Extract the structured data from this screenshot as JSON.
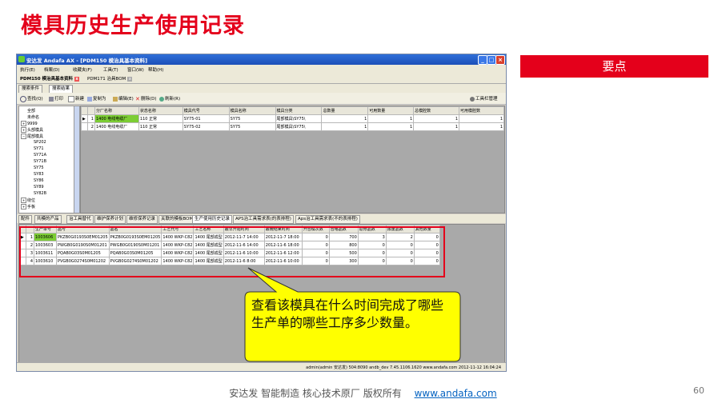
{
  "slide": {
    "title": "模具历史生产使用记录",
    "keypoint_label": "要点",
    "footer_text": "安达发  智能制造 核心技术原厂   版权所有",
    "footer_link": "www.andafa.com",
    "page_number": "60",
    "callout_text": "查看该模具在什么时间完成了哪些生产单的哪些工序多少数量。"
  },
  "window": {
    "title": "安达发 Andafa AX - [PDM150 模治具基本资料]",
    "menu": [
      "执行(E)",
      "档案(D)",
      "收藏夹(F)",
      "工具(T)",
      "窗口(W)",
      "帮助(H)"
    ],
    "doc_tabs": [
      "PDM150 模治具基本资料",
      "PDM171 治具BOM"
    ],
    "sub_tabs": [
      "搜索条件",
      "搜索结果"
    ],
    "toolbar": [
      "查找(Q)",
      "打印",
      "新建",
      "复制为",
      "编辑(E)",
      "删除(D)",
      "刷新(R)"
    ],
    "tool_manage": "工具栏管理",
    "tree": [
      "全部",
      "未命名",
      "9999",
      "头部模具",
      "尾部模具",
      "SP202",
      "SY71",
      "SY71A",
      "SY71B",
      "SY75",
      "SY83",
      "SY86",
      "SY89",
      "SY82B",
      "绕位",
      "手板"
    ],
    "status": "admin(admin 安达发)  504:8090  andb_dev  7.45.1106.1620  www.andafa.com  2012-11-12 16:04:24"
  },
  "upper_grid": {
    "headers": [
      "",
      "",
      "分厂名称",
      "状态名称",
      "模具代号",
      "模具名称",
      "模具分类",
      "总数量",
      "可用数量",
      "总模腔数",
      "可用模腔数"
    ],
    "rows": [
      [
        "▶",
        "1",
        "1400 电线电缆厂",
        "110 正常",
        "SY75-01",
        "SY75",
        "尾部模具\\SY75\\",
        "1",
        "1",
        "1",
        "1"
      ],
      [
        "",
        "2",
        "1400 电线电缆厂",
        "110 正常",
        "SY75-02",
        "SY75",
        "尾部模具\\SY75\\",
        "1",
        "1",
        "1",
        "1"
      ]
    ]
  },
  "lower_tabs": [
    "配件",
    "共模的产品",
    "治工具替代",
    "维护保养计划",
    "维修保养记录",
    "关联的模板BOM",
    "生产使用历史记录",
    "APS治工具需求表(的表排程)",
    "Aps治工具需求表(不的表排程)"
  ],
  "lower_grid": {
    "headers": [
      "",
      "",
      "生产单号",
      "品号",
      "品名",
      "工艺代号",
      "工艺名称",
      "最早开始时间",
      "最晚结束时间",
      "开合模次数",
      "合格品数",
      "返修品数",
      "报废品数",
      "其他数量"
    ],
    "rows": [
      [
        "▶",
        "1",
        "1003606",
        "PKZB0G0193S0EM01205",
        "PKZB0G0193S0EM01205",
        "1400 WKP-C82",
        "1400 尾部成型",
        "2012-11-7 14:00",
        "2012-11-7 18:00",
        "0",
        "700",
        "3",
        "2",
        "0"
      ],
      [
        "",
        "2",
        "1003603",
        "PWGB0G0190S0M01201",
        "PWGB0G0190S0M01201",
        "1400 WKP-C82",
        "1400 尾部成型",
        "2012-11-6 14:00",
        "2012-11-6 18:00",
        "0",
        "800",
        "0",
        "0",
        "0"
      ],
      [
        "",
        "3",
        "1003611",
        "PQAB0G03S0M01205",
        "PQAB0G03S0M01205",
        "1400 WKP-C82",
        "1400 尾部成型",
        "2012-11-6 10:00",
        "2012-11-6 12:00",
        "0",
        "500",
        "0",
        "0",
        "0"
      ],
      [
        "",
        "4",
        "1003610",
        "PVGB0G0274S0M01202",
        "PVGB0G0274S0M01202",
        "1400 WKP-C82",
        "1400 尾部成型",
        "2012-11-6 8:00",
        "2012-11-6 10:00",
        "0",
        "300",
        "0",
        "0",
        "0"
      ]
    ]
  },
  "colors": {
    "accent_red": "#e4001b",
    "callout_fill": "#ffff00",
    "selected_cell": "#7ccd34"
  }
}
